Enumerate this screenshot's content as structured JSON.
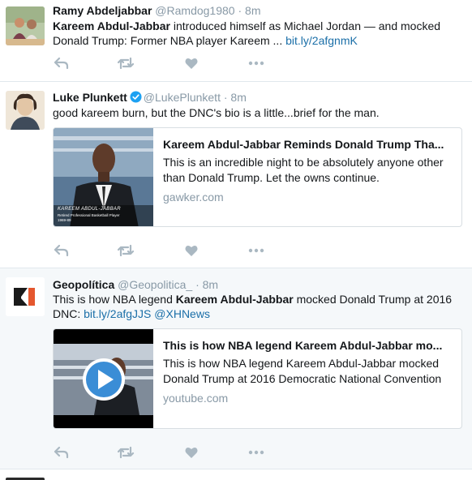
{
  "tweets": [
    {
      "name": "Ramy Abdeljabbar",
      "handle": "@Ramdog1980",
      "time": "8m",
      "text_bold": "Kareem Abdul-Jabbar",
      "text_rest": " introduced himself as Michael Jordan — and mocked Donald Trump: Former NBA player Kareem ... ",
      "link": "bit.ly/2afgnmK"
    },
    {
      "name": "Luke Plunkett",
      "handle": "@LukePlunkett",
      "time": "8m",
      "verified": true,
      "text": "good kareem burn, but the DNC's bio is a little...brief for the man.",
      "card": {
        "title": "Kareem Abdul-Jabbar Reminds Donald Trump Tha...",
        "description": "This is an incredible night to be absolutely anyone other than Donald Trump. Let the owns continue.",
        "domain": "gawker.com",
        "caption_name": "KAREEM ABDUL-JABBAR",
        "caption_sub": "Retired Professional Basketball Player",
        "caption_years": "1969-89"
      }
    },
    {
      "name": "Geopolítica",
      "handle": "@Geopolitica_",
      "time": "8m",
      "text_pre": "This is how NBA legend ",
      "text_bold": "Kareem Abdul-Jabbar",
      "text_post": " mocked Donald Trump at 2016 DNC:  ",
      "link": "bit.ly/2afgJJS",
      "mention": "@XHNews",
      "card": {
        "title": "This is how NBA legend Kareem Abdul-Jabbar mo...",
        "description": "This is how NBA legend Kareem Abdul-Jabbar mocked Donald Trump at 2016 Democratic National Convention",
        "domain": "youtube.com"
      }
    }
  ],
  "icons": [
    "reply-icon",
    "retweet-icon",
    "like-icon",
    "more-icon"
  ],
  "colors": {
    "icon": "#aab8c2",
    "link": "#1b6fa8",
    "muted": "#8899a6",
    "verified": "#1da1f2",
    "highlight_bg": "#f5f8fa"
  }
}
